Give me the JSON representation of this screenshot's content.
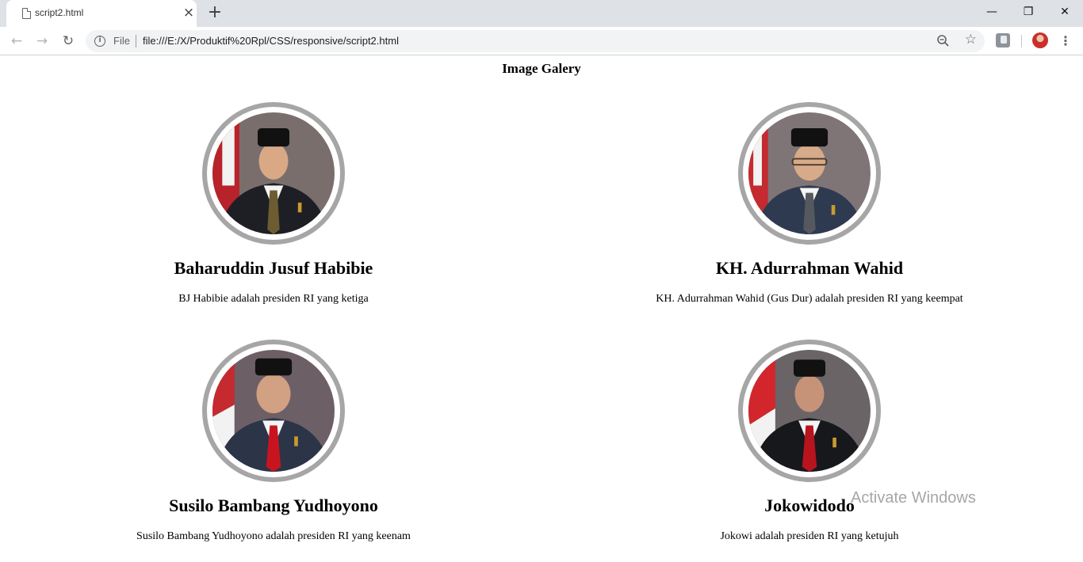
{
  "browser": {
    "tab_title": "script2.html",
    "url_scheme": "File",
    "url": "file:///E:/X/Produktif%20Rpl/CSS/responsive/script2.html"
  },
  "page": {
    "heading": "Image Galery",
    "cards": [
      {
        "name": "Baharuddin Jusuf Habibie",
        "description": "BJ Habibie adalah presiden RI yang ketiga"
      },
      {
        "name": "KH. Adurrahman Wahid",
        "description": "KH. Adurrahman Wahid (Gus Dur) adalah presiden RI yang keempat"
      },
      {
        "name": "Susilo Bambang Yudhoyono",
        "description": "Susilo Bambang Yudhoyono adalah presiden RI yang keenam"
      },
      {
        "name": "Jokowidodo",
        "description": "Jokowi adalah presiden RI yang ketujuh"
      }
    ]
  },
  "os": {
    "watermark": "Activate Windows"
  }
}
